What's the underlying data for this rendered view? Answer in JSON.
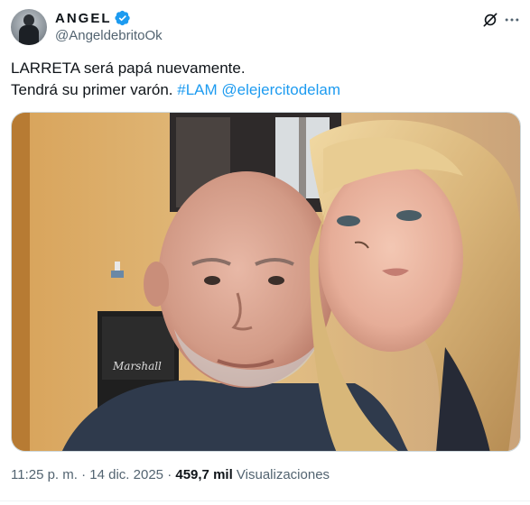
{
  "author": {
    "display_name": "ANGEL",
    "handle": "@AngeldebritoOk",
    "verified": true,
    "avatar_icon": "person-avatar-icon"
  },
  "header_icons": [
    "grok-icon",
    "more-options-icon"
  ],
  "tweet": {
    "line1": "LARRETA será papá nuevamente.",
    "line2_text": "Tendrá su primer varón.",
    "hashtag": "#LAM",
    "mention": "@elejercitodelam"
  },
  "media": {
    "description_icon": "selfie-photo",
    "amp_text": "Marshall"
  },
  "meta": {
    "time": "11:25 p. m.",
    "separator1": "·",
    "date": "14 dic. 2025",
    "separator2": "·",
    "views_count": "459,7 mil",
    "views_label": "Visualizaciones"
  },
  "colors": {
    "link": "#1d9bf0",
    "verified": "#1d9bf0",
    "secondary_text": "#536471",
    "primary_text": "#0f1419"
  }
}
